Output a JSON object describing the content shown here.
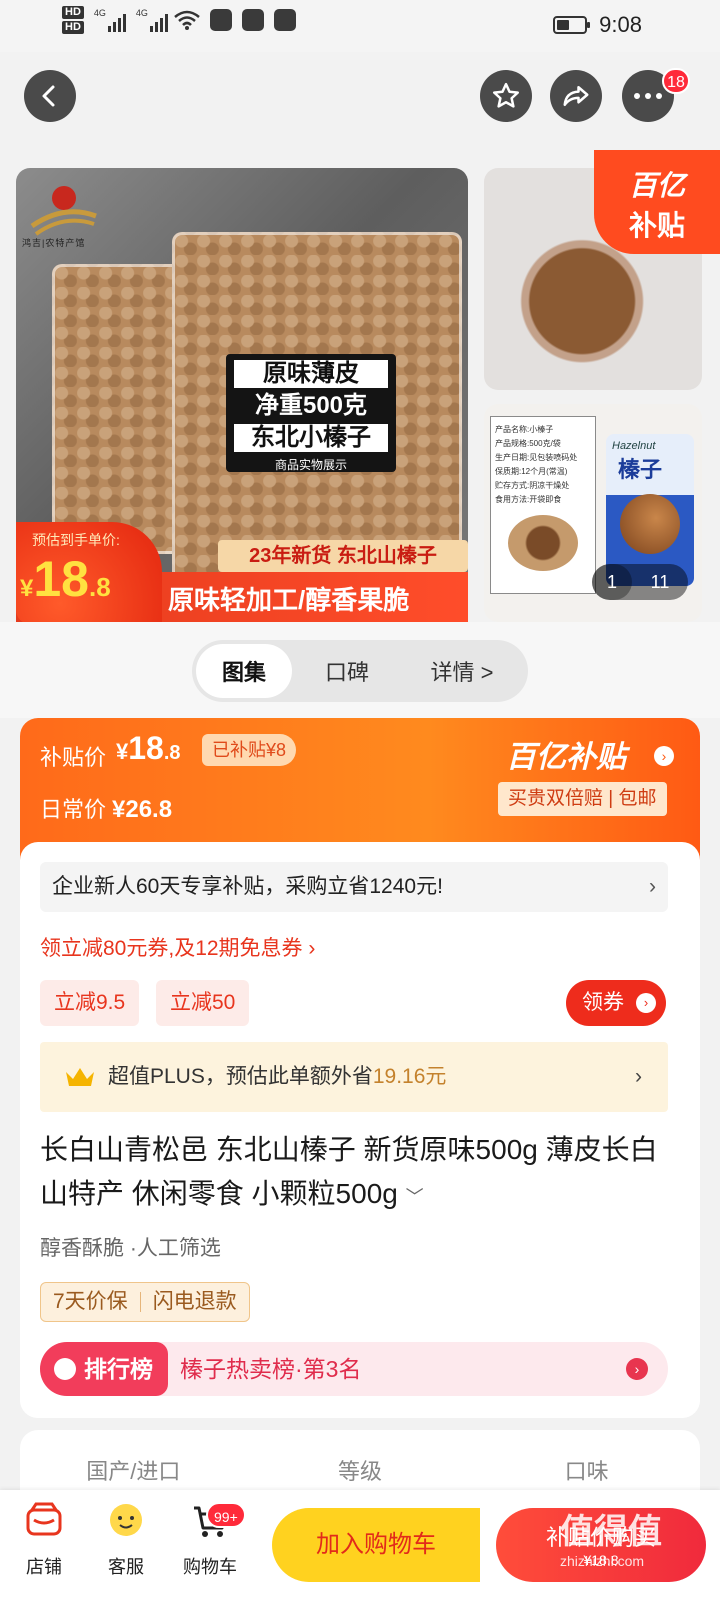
{
  "status_bar": {
    "hd1": "HD",
    "hd2": "HD",
    "sig1_label": "4G",
    "sig2_label": "4G",
    "time": "9:08"
  },
  "nav": {
    "badge": "18"
  },
  "gallery": {
    "logo_caption": "鸿吉|农特产馆",
    "label_line1": "原味薄皮",
    "label_line2": "净重500克",
    "label_line3": "东北小榛子",
    "label_line4": "商品实物展示",
    "new_goods": "23年新货 东北山榛子",
    "slogan": "原味轻加工/醇香果脆",
    "est_label": "预估到手单价:",
    "est_yen": "¥",
    "est_int": "18",
    "est_dec": ".8",
    "yiyi_line1": "百亿",
    "yiyi_line2": "补贴",
    "info_lines": [
      "产品名称:小榛子",
      "产品规格:500克/袋",
      "生产日期:见包装喷码处",
      "保质期:12个月(常温)",
      "贮存方式:阴凉干燥处",
      "食用方法:开袋即食"
    ],
    "hazel_en": "Hazelnut",
    "hazel_cn": "榛子",
    "page_current": "1",
    "page_total": "11"
  },
  "tabs": [
    {
      "label": "图集"
    },
    {
      "label": "口碑"
    },
    {
      "label": "详情 >"
    }
  ],
  "price": {
    "subsidy_label": "补贴价",
    "subsidy_yen": "¥",
    "subsidy_int": "18",
    "subsidy_dec": ".8",
    "subsidy_saved": "已补贴¥8",
    "daily_label": "日常价",
    "daily_price": "¥26.8",
    "yiyi_brand": "百亿补贴",
    "yiyi_arrow": "›",
    "guarantee": "买贵双倍赔 | 包邮"
  },
  "promo": {
    "enterprise": "企业新人60天专享补贴，采购立省1240元!",
    "enterprise_chev": "›",
    "coupon_line": "领立减80元券,及12期免息券 ›",
    "coupon1": "立减9.5",
    "coupon2": "立减50",
    "get_coupon": "领券",
    "get_coupon_arrow": "›",
    "plus_prefix": "超值PLUS，预估此单额外省",
    "plus_amount": "19.16元",
    "plus_chev": "›"
  },
  "product": {
    "title": "长白山青松邑 东北山榛子 新货原味500g 薄皮长白山特产 休闲零食 小颗粒500g",
    "title_arrow": "﹀",
    "tags": "醇香酥脆 ·人工筛选",
    "guarantee1": "7天价保",
    "guarantee2": "闪电退款",
    "rank_label": "排行榜",
    "rank_text": "榛子热卖榜·第3名",
    "rank_arrow": "›"
  },
  "specs": [
    "国产/进口",
    "等级",
    "口味"
  ],
  "bottom_bar": {
    "shop": "店铺",
    "service": "客服",
    "cart": "购物车",
    "cart_badge": "99+",
    "add_cart": "加入购物车",
    "buy_now": "补贴价购买",
    "buy_price": "¥18.8"
  },
  "watermark": {
    "line1": "值得值",
    "line2": "zhizhizhi.com"
  },
  "colors": {
    "accent_red": "#ee2c1c",
    "subsidy_orange": "#ff6a1a",
    "cart_yellow": "#ffd21f"
  }
}
